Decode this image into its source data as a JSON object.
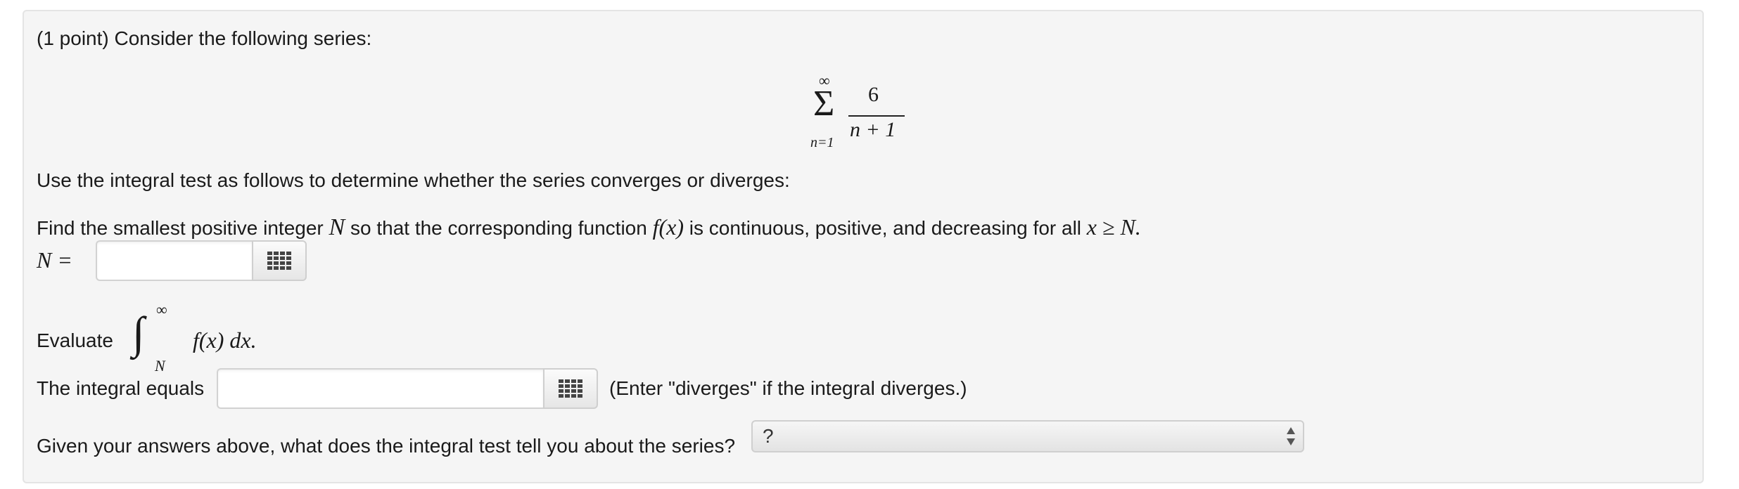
{
  "problem": {
    "intro": "(1 point) Consider the following series:",
    "series": {
      "upper_limit": "∞",
      "sigma": "Σ",
      "numerator": "6",
      "denominator": "n + 1",
      "lower_limit": "n=1"
    },
    "instruction": "Use the integral test as follows to determine whether the series converges or diverges:",
    "step1": {
      "text_a": "Find the smallest positive integer ",
      "var_N": "N",
      "text_b": " so that the corresponding function ",
      "func": "f(x)",
      "text_c": " is continuous, positive, and decreasing for all ",
      "cond": "x ≥ N.",
      "label": "N =",
      "input_value": ""
    },
    "step2": {
      "evaluate_label": "Evaluate",
      "integral_sign": "∫",
      "upper": "∞",
      "lower": "N",
      "integrand": "f(x) dx.",
      "equals_label": "The integral equals",
      "input_value": "",
      "note": "(Enter \"diverges\" if the integral diverges.)"
    },
    "step3": {
      "question": "Given your answers above, what does the integral test tell you about the series?",
      "selected": "?"
    }
  },
  "icons": {
    "palette": "equation-palette-icon",
    "select_arrows": "updown-arrows-icon"
  },
  "colors": {
    "panel_bg": "#f5f5f5",
    "panel_border": "#e4e4e4",
    "palette_icon": "#444444"
  }
}
